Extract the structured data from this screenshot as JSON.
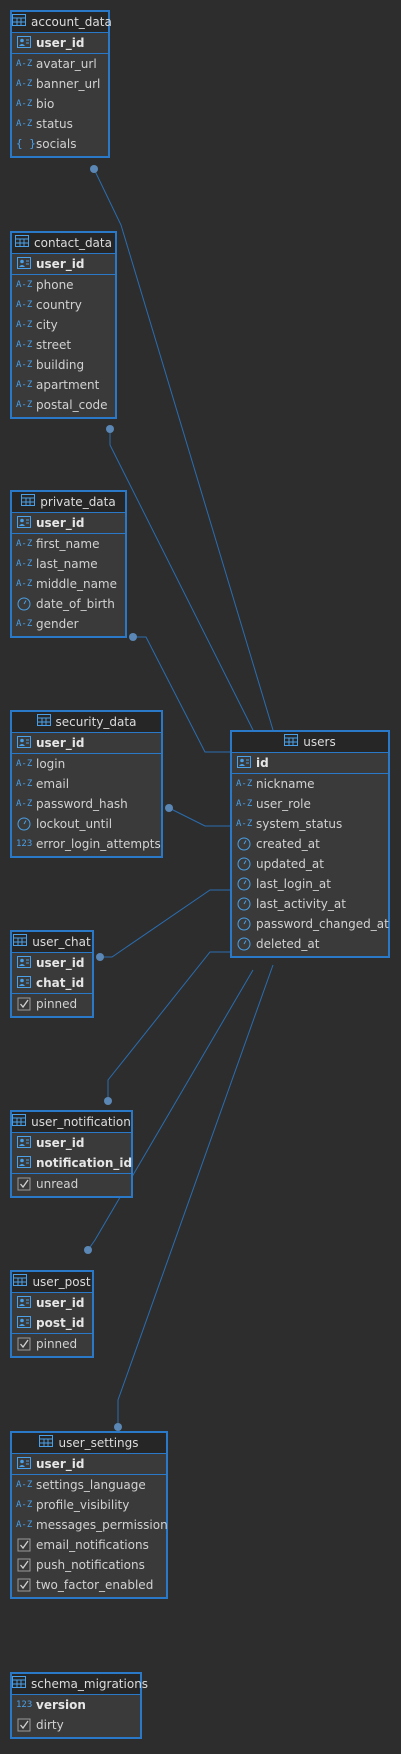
{
  "colors": {
    "background": "#2d2d2d",
    "border": "#2a78c8",
    "link": "#2a6db0",
    "icon": "#4aa0e8"
  },
  "tables": {
    "account_data": {
      "title": "account_data",
      "keys": [
        "user_id"
      ],
      "cols": [
        {
          "name": "avatar_url",
          "icon": "text"
        },
        {
          "name": "banner_url",
          "icon": "text"
        },
        {
          "name": "bio",
          "icon": "text"
        },
        {
          "name": "status",
          "icon": "text"
        },
        {
          "name": "socials",
          "icon": "json"
        }
      ]
    },
    "contact_data": {
      "title": "contact_data",
      "keys": [
        "user_id"
      ],
      "cols": [
        {
          "name": "phone",
          "icon": "text"
        },
        {
          "name": "country",
          "icon": "text"
        },
        {
          "name": "city",
          "icon": "text"
        },
        {
          "name": "street",
          "icon": "text"
        },
        {
          "name": "building",
          "icon": "text"
        },
        {
          "name": "apartment",
          "icon": "text"
        },
        {
          "name": "postal_code",
          "icon": "text"
        }
      ]
    },
    "private_data": {
      "title": "private_data",
      "keys": [
        "user_id"
      ],
      "cols": [
        {
          "name": "first_name",
          "icon": "text"
        },
        {
          "name": "last_name",
          "icon": "text"
        },
        {
          "name": "middle_name",
          "icon": "text"
        },
        {
          "name": "date_of_birth",
          "icon": "time"
        },
        {
          "name": "gender",
          "icon": "text"
        }
      ]
    },
    "security_data": {
      "title": "security_data",
      "keys": [
        "user_id"
      ],
      "cols": [
        {
          "name": "login",
          "icon": "text"
        },
        {
          "name": "email",
          "icon": "text"
        },
        {
          "name": "password_hash",
          "icon": "text"
        },
        {
          "name": "lockout_until",
          "icon": "time"
        },
        {
          "name": "error_login_attempts",
          "icon": "num"
        }
      ]
    },
    "users": {
      "title": "users",
      "keys": [
        "id"
      ],
      "cols": [
        {
          "name": "nickname",
          "icon": "text"
        },
        {
          "name": "user_role",
          "icon": "text"
        },
        {
          "name": "system_status",
          "icon": "text"
        },
        {
          "name": "created_at",
          "icon": "time"
        },
        {
          "name": "updated_at",
          "icon": "time"
        },
        {
          "name": "last_login_at",
          "icon": "time"
        },
        {
          "name": "last_activity_at",
          "icon": "time"
        },
        {
          "name": "password_changed_at",
          "icon": "time"
        },
        {
          "name": "deleted_at",
          "icon": "time"
        }
      ]
    },
    "user_chat": {
      "title": "user_chat",
      "keys": [
        "user_id",
        "chat_id"
      ],
      "cols": [
        {
          "name": "pinned",
          "icon": "bool"
        }
      ]
    },
    "user_notification": {
      "title": "user_notification",
      "keys": [
        "user_id",
        "notification_id"
      ],
      "cols": [
        {
          "name": "unread",
          "icon": "bool"
        }
      ]
    },
    "user_post": {
      "title": "user_post",
      "keys": [
        "user_id",
        "post_id"
      ],
      "cols": [
        {
          "name": "pinned",
          "icon": "bool"
        }
      ]
    },
    "user_settings": {
      "title": "user_settings",
      "keys": [
        "user_id"
      ],
      "cols": [
        {
          "name": "settings_language",
          "icon": "text"
        },
        {
          "name": "profile_visibility",
          "icon": "text"
        },
        {
          "name": "messages_permission",
          "icon": "text"
        },
        {
          "name": "email_notifications",
          "icon": "bool"
        },
        {
          "name": "push_notifications",
          "icon": "bool"
        },
        {
          "name": "two_factor_enabled",
          "icon": "bool"
        }
      ]
    },
    "schema_migrations": {
      "title": "schema_migrations",
      "keys": [],
      "cols": [
        {
          "name": "version",
          "icon": "num",
          "bold": true
        },
        {
          "name": "dirty",
          "icon": "bool"
        }
      ]
    }
  }
}
